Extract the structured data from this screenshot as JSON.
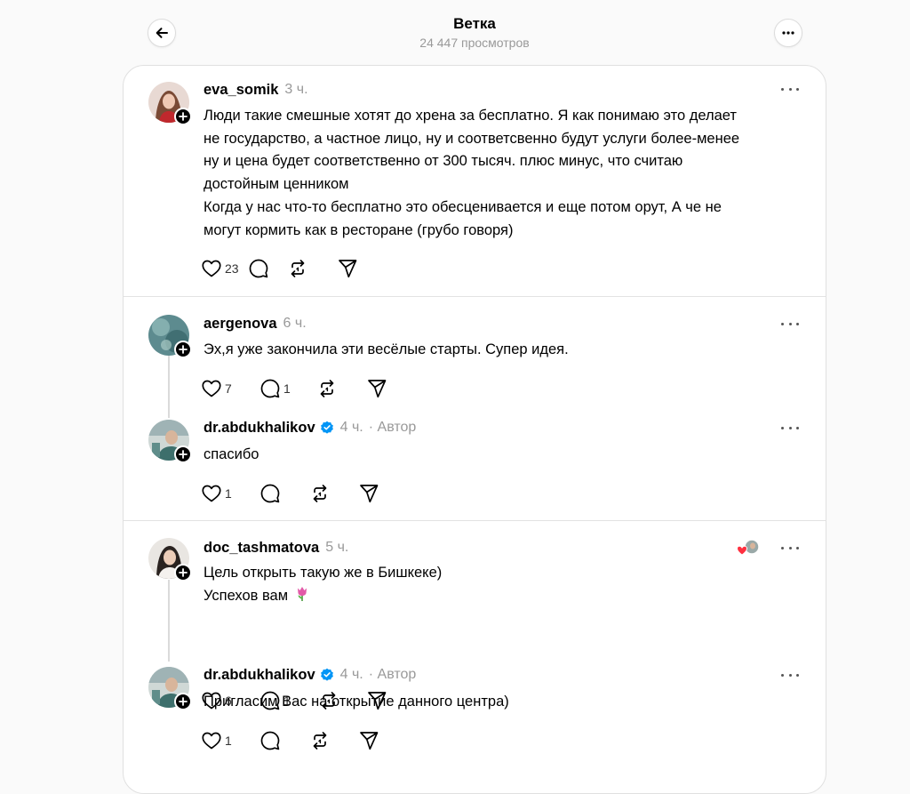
{
  "header": {
    "title": "Ветка",
    "views": "24 447 просмотров"
  },
  "icons": {
    "back": "arrow-left-icon",
    "more": "more-horizontal-icon",
    "like": "heart-icon",
    "reply": "speech-bubble-icon",
    "repost": "repost-icon",
    "share": "send-icon",
    "verified": "verified-badge-icon",
    "follow": "plus-icon",
    "tulip": "tulip-emoji-icon"
  },
  "colors": {
    "verified": "#0095f6",
    "like_red": "#ff3040"
  },
  "posts": [
    {
      "username": "eva_somik",
      "time": "3 ч.",
      "lines": [
        "Люди такие смешные хотят до хрена за бесплатно. Я как понимаю это делает",
        "не государство, а частное лицо, ну и соответсвенно будут услуги более-менее",
        "ну и цена будет соответственно от 300 тысяч. плюс минус, что считаю",
        "достойным ценником",
        "Когда у нас что-то бесплатно это обесценивается и еще потом орут, А че не",
        "могут кормить как в ресторане (грубо говоря)"
      ],
      "likes": "23",
      "replies": ""
    },
    {
      "username": "aergenova",
      "time": "6 ч.",
      "lines": [
        "Эх,я уже закончила эти весёлые старты. Супер идея."
      ],
      "likes": "7",
      "replies": "1"
    },
    {
      "username": "dr.abdukhalikov",
      "time": "4 ч.",
      "author_label": "· Автор",
      "lines": [
        "спасибо"
      ],
      "likes": "1",
      "replies": ""
    },
    {
      "username": "doc_tashmatova",
      "time": "5 ч.",
      "lines": [
        "Цель открыть такую же в Бишкеке)",
        "Успехов вам"
      ],
      "likes": "6",
      "replies": "1"
    },
    {
      "username": "dr.abdukhalikov",
      "time": "4 ч.",
      "author_label": "· Автор",
      "lines": [
        "Пригласим Вас на открытие данного центра)"
      ],
      "likes": "1",
      "replies": ""
    }
  ]
}
